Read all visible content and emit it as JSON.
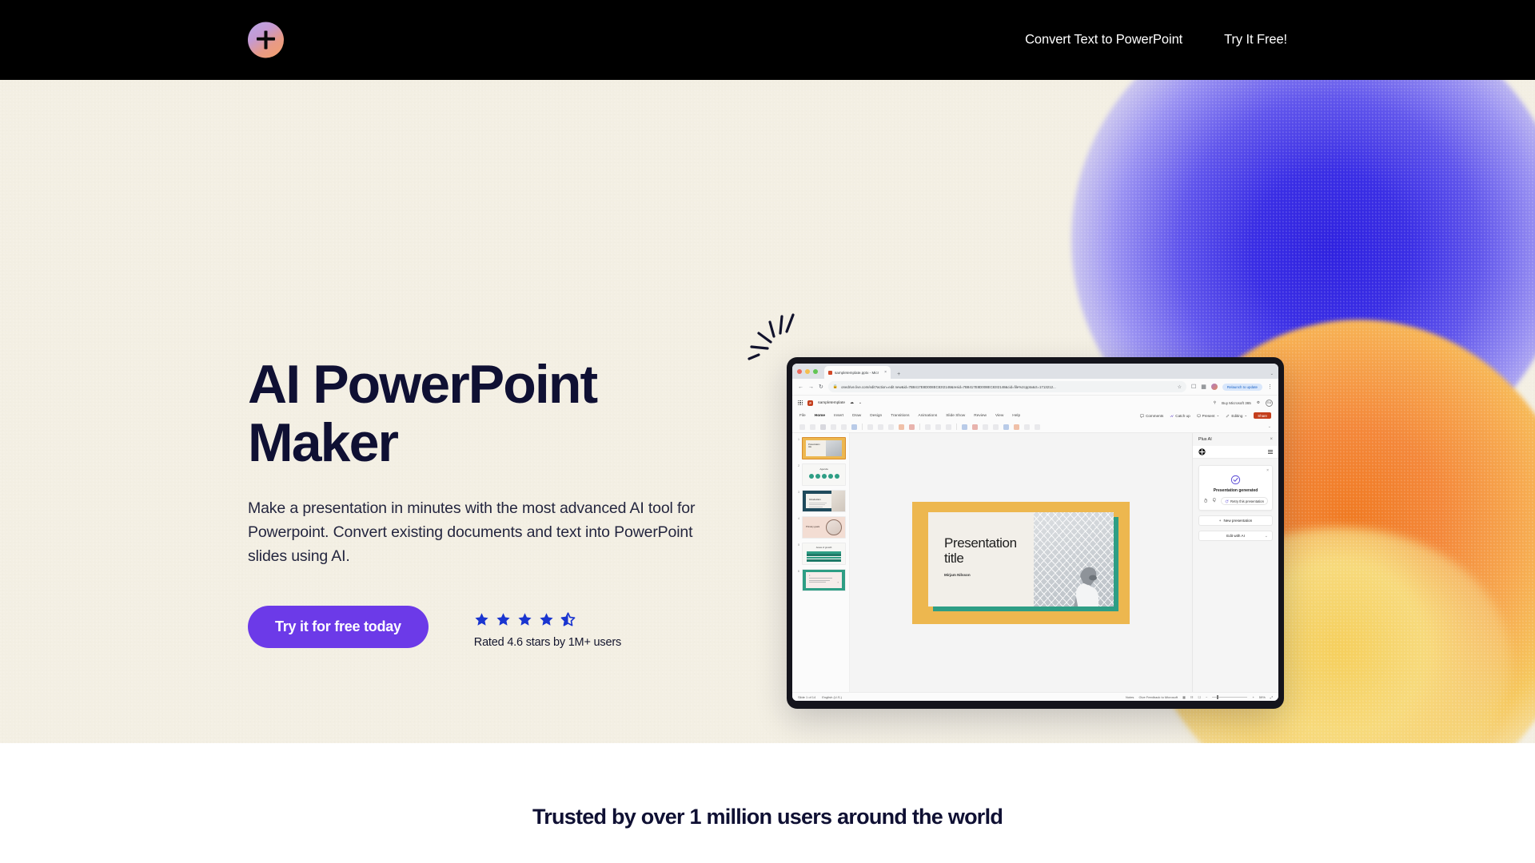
{
  "nav": {
    "logo_icon": "plus-ai-star-logo",
    "links": [
      {
        "label": "Convert Text to PowerPoint",
        "name": "nav-link-convert-text-to-powerpoint"
      },
      {
        "label": "Try It Free!",
        "name": "nav-link-try-it-free"
      }
    ]
  },
  "hero": {
    "title": "AI PowerPoint Maker",
    "subtitle": "Make a presentation in minutes with the most advanced AI tool for Powerpoint. Convert existing documents and text into PowerPoint slides using AI.",
    "cta_label": "Try it for free today",
    "rating": {
      "value": 4.6,
      "stars_filled": 4,
      "stars_half": 1,
      "stars_total": 5,
      "text": "Rated 4.6 stars by 1M+ users",
      "star_color": "#1a35d0"
    },
    "accent_color": "#6c3ae8",
    "background_color": "#f3efe3",
    "title_color": "#0f1033"
  },
  "mockup": {
    "browser": {
      "tab_title": "sampletemplate.pptx - Micr",
      "tab_close": "×",
      "new_tab": "+",
      "window_caret": "⌄",
      "back": "←",
      "forward": "→",
      "reload": "↻",
      "lock_icon": "lock-icon",
      "url": "onedrive.live.com/edit?action=edit new&id=7B8417E8D008EC83!2148&resid=7B8417E8D008EC83!2148&cid=file%2cpptx&ct=1713212...",
      "star_icon": "☆",
      "relaunch_label": "Relaunch to update",
      "menu_icon": "⋮"
    },
    "app": {
      "waffle_icon": "app-launcher-icon",
      "file_name": "sampletemplate",
      "autosave_icon": "autosave-icon",
      "search_icon": "⚲",
      "buy_label": "Buy Microsoft 365",
      "settings_icon": "⚙",
      "user_initials": "GU",
      "ribbon_tabs": [
        "File",
        "Home",
        "Insert",
        "Draw",
        "Design",
        "Transitions",
        "Animations",
        "Slide Show",
        "Review",
        "View",
        "Help"
      ],
      "active_ribbon_tab": "Home",
      "ribbon_actions": [
        {
          "label": "Comments",
          "icon": "comment-icon"
        },
        {
          "label": "Catch up",
          "icon": "catchup-icon"
        },
        {
          "label": "Present",
          "icon": "present-icon"
        },
        {
          "label": "Editing",
          "icon": "pencil-icon"
        }
      ],
      "share_label": "Share",
      "share_color": "#c43e1c"
    },
    "slides": [
      {
        "num": "1",
        "kind": "title",
        "selected": true
      },
      {
        "num": "2",
        "kind": "agenda",
        "title": "Agenda",
        "selected": false
      },
      {
        "num": "3",
        "kind": "introduction",
        "title": "Introduction",
        "selected": false
      },
      {
        "num": "4",
        "kind": "primary-goals",
        "title": "Primary goals",
        "selected": false
      },
      {
        "num": "5",
        "kind": "areas-of-growth",
        "title": "Areas of growth",
        "selected": false
      },
      {
        "num": "6",
        "kind": "quote",
        "title": "Quote",
        "selected": false
      }
    ],
    "canvas_slide": {
      "title": "Presentation title",
      "author": "Mirjam Nilsson",
      "bg_color": "#edb74f",
      "accent_color": "#2e9e85"
    },
    "plus_ai_panel": {
      "title": "Plus AI",
      "close_icon": "×",
      "logo_icon": "plus-ai-logo-icon",
      "menu_icon": "panel-menu-icon",
      "card": {
        "close_icon": "×",
        "status_icon": "check-circle-icon",
        "status_text": "Presentation generated",
        "thumbs_up_icon": "👍",
        "thumbs_down_icon": "👎",
        "retry_icon": "↻",
        "retry_label": "Retry this presentation"
      },
      "new_presentation_label": "New presentation",
      "new_presentation_icon": "+",
      "edit_with_ai_label": "Edit with AI",
      "edit_with_ai_caret": "⌄"
    },
    "status_bar": {
      "slide_counter": "Slide 1 of 14",
      "language": "English (U.S.)",
      "notes_label": "Notes",
      "feedback_label": "Give Feedback to Microsoft",
      "view_icons": [
        "normal-view-icon",
        "sorter-view-icon",
        "reading-view-icon"
      ],
      "zoom_out": "−",
      "zoom_in": "+",
      "zoom_level": "59%",
      "fit_icon": "fit-to-window-icon"
    }
  },
  "trusted": {
    "heading": "Trusted by over 1 million users around the world"
  }
}
